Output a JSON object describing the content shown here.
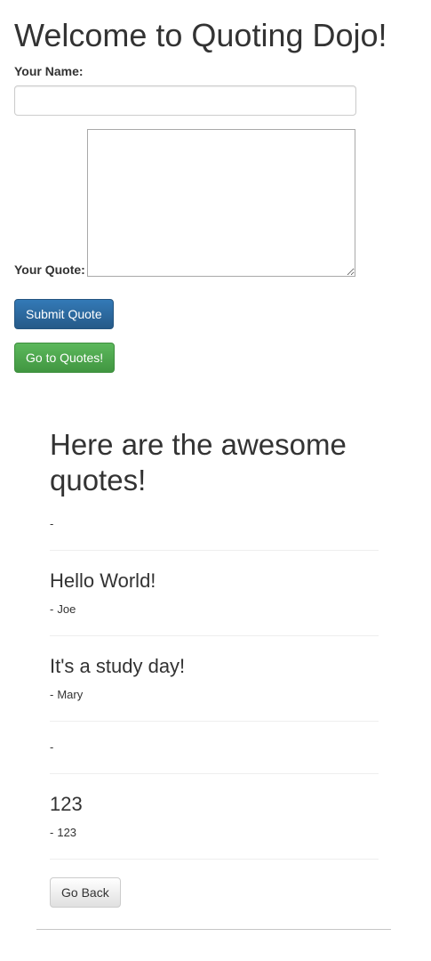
{
  "header": {
    "title": "Welcome to Quoting Dojo!"
  },
  "form": {
    "name_label": "Your Name:",
    "name_value": "",
    "quote_label": "Your Quote:",
    "quote_value": "",
    "submit_label": "Submit Quote",
    "goto_label": "Go to Quotes!"
  },
  "quotes_section": {
    "title": "Here are the awesome quotes!",
    "dash": "-",
    "quotes": [
      {
        "text": "",
        "author": ""
      },
      {
        "text": "Hello World!",
        "author": "Joe"
      },
      {
        "text": "It's a study day!",
        "author": "Mary"
      },
      {
        "text": "",
        "author": ""
      },
      {
        "text": "123",
        "author": "123"
      }
    ],
    "back_label": "Go Back"
  },
  "colors": {
    "primary": "#337ab7",
    "success": "#5cb85c",
    "text": "#333333"
  }
}
